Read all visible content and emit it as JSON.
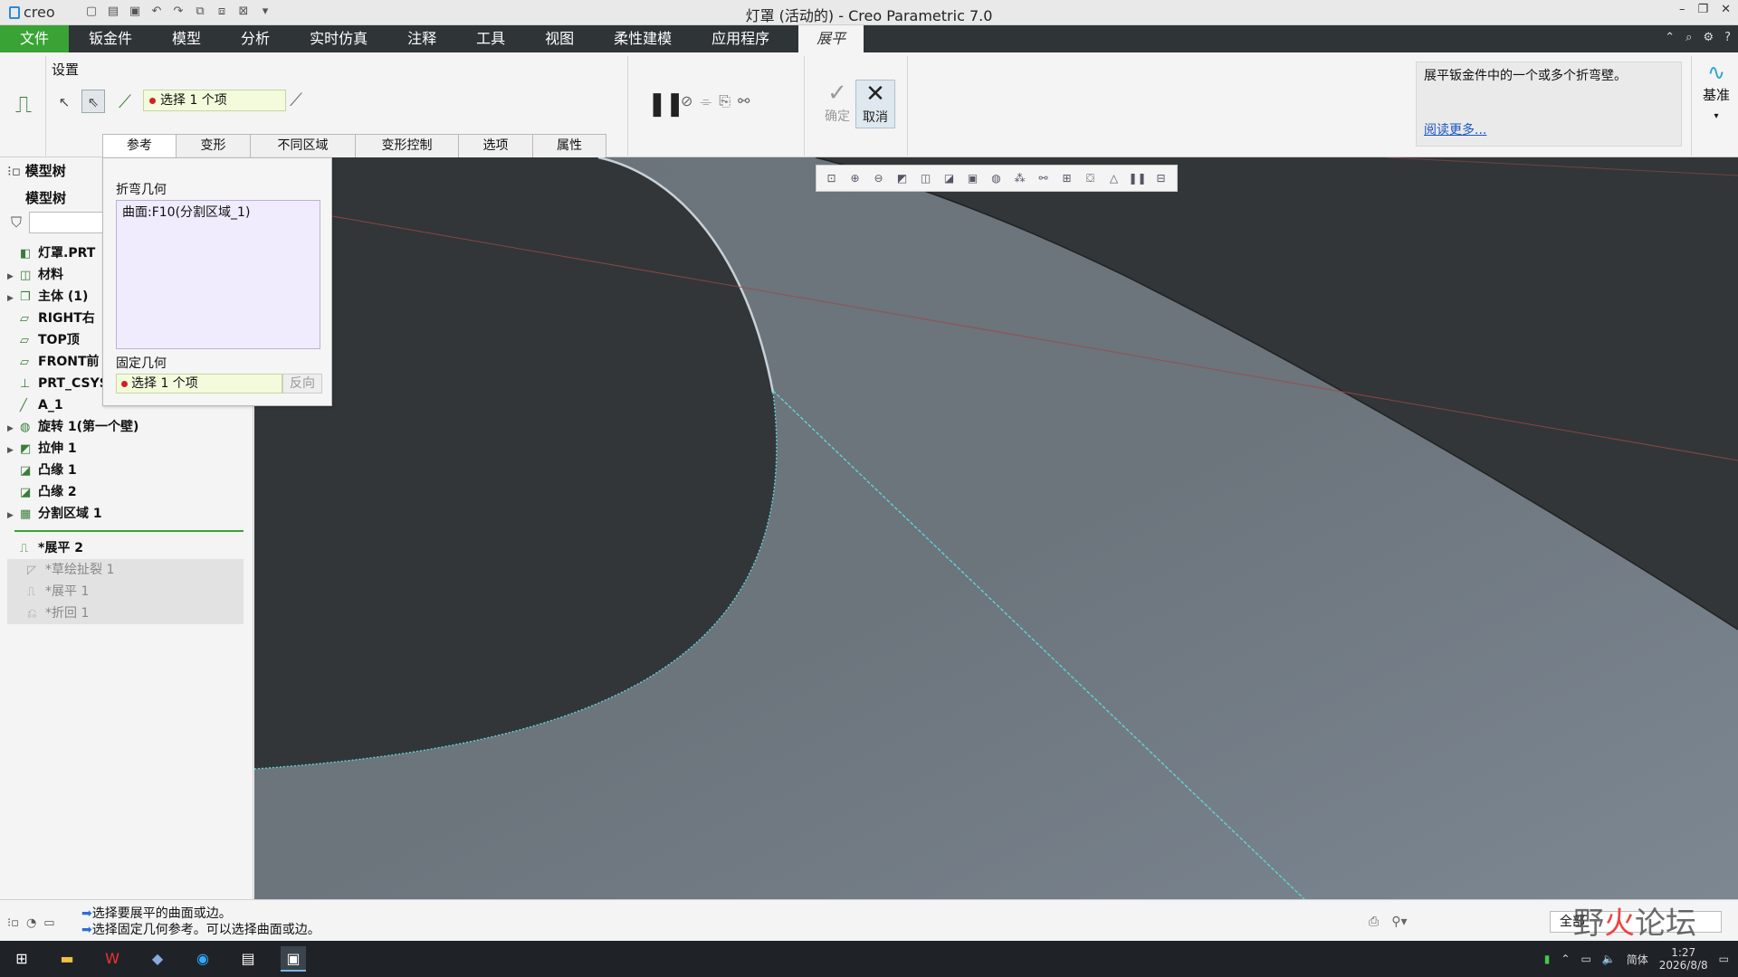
{
  "titlebar": {
    "app_name": "creo",
    "title": "灯罩 (活动的) - Creo Parametric 7.0"
  },
  "tabs": [
    {
      "label": "文件"
    },
    {
      "label": "钣金件"
    },
    {
      "label": "模型"
    },
    {
      "label": "分析"
    },
    {
      "label": "实时仿真"
    },
    {
      "label": "注释"
    },
    {
      "label": "工具"
    },
    {
      "label": "视图"
    },
    {
      "label": "柔性建模"
    },
    {
      "label": "应用程序"
    },
    {
      "label": "展平"
    }
  ],
  "ribbon": {
    "settings_label": "设置",
    "collector_text": "选择 1 个项",
    "ok_label": "确定",
    "cancel_label": "取消",
    "help_text": "展平钣金件中的一个或多个折弯壁。",
    "help_more": "阅读更多...",
    "datum_label": "基准"
  },
  "subtabs": [
    {
      "label": "参考"
    },
    {
      "label": "变形"
    },
    {
      "label": "不同区域"
    },
    {
      "label": "变形控制"
    },
    {
      "label": "选项"
    },
    {
      "label": "属性"
    }
  ],
  "refpanel": {
    "bend_label": "折弯几何",
    "bend_item": "曲面:F10(分割区域_1)",
    "fixed_label": "固定几何",
    "fixed_collector": "选择 1 个项",
    "flip_label": "反向"
  },
  "tree": {
    "tab_label": "模型树",
    "header": "模型树",
    "items": [
      {
        "label": "灯罩.PRT",
        "arrow": "",
        "icon": "◧"
      },
      {
        "label": "材料",
        "arrow": "▶",
        "icon": "◫"
      },
      {
        "label": "主体 (1)",
        "arrow": "▶",
        "icon": "❒"
      },
      {
        "label": "RIGHT右",
        "arrow": "",
        "icon": "▱"
      },
      {
        "label": "TOP顶",
        "arrow": "",
        "icon": "▱"
      },
      {
        "label": "FRONT前",
        "arrow": "",
        "icon": "▱"
      },
      {
        "label": "PRT_CSYS",
        "arrow": "",
        "icon": "⊥"
      },
      {
        "label": "A_1",
        "arrow": "",
        "icon": "╱"
      },
      {
        "label": "旋转 1(第一个壁)",
        "arrow": "▶",
        "icon": "◍"
      },
      {
        "label": "拉伸 1",
        "arrow": "▶",
        "icon": "◩"
      },
      {
        "label": "凸缘 1",
        "arrow": "",
        "icon": "◪"
      },
      {
        "label": "凸缘 2",
        "arrow": "",
        "icon": "◪"
      },
      {
        "label": "分割区域 1",
        "arrow": "▶",
        "icon": "▦"
      }
    ],
    "active_item": "*展平 2",
    "dim_items": [
      {
        "label": "*草绘扯裂 1"
      },
      {
        "label": "*展平 1"
      },
      {
        "label": "*折回 1"
      }
    ]
  },
  "status": {
    "msg1": "选择要展平的曲面或边。",
    "msg2": "选择固定几何参考。可以选择曲面或边。",
    "filter": "全部",
    "watermark_a": "野",
    "watermark_b": "火",
    "watermark_c": "论坛"
  },
  "taskbar": {
    "time": "1:27",
    "date": "2026/8/8",
    "ime": "简体"
  }
}
